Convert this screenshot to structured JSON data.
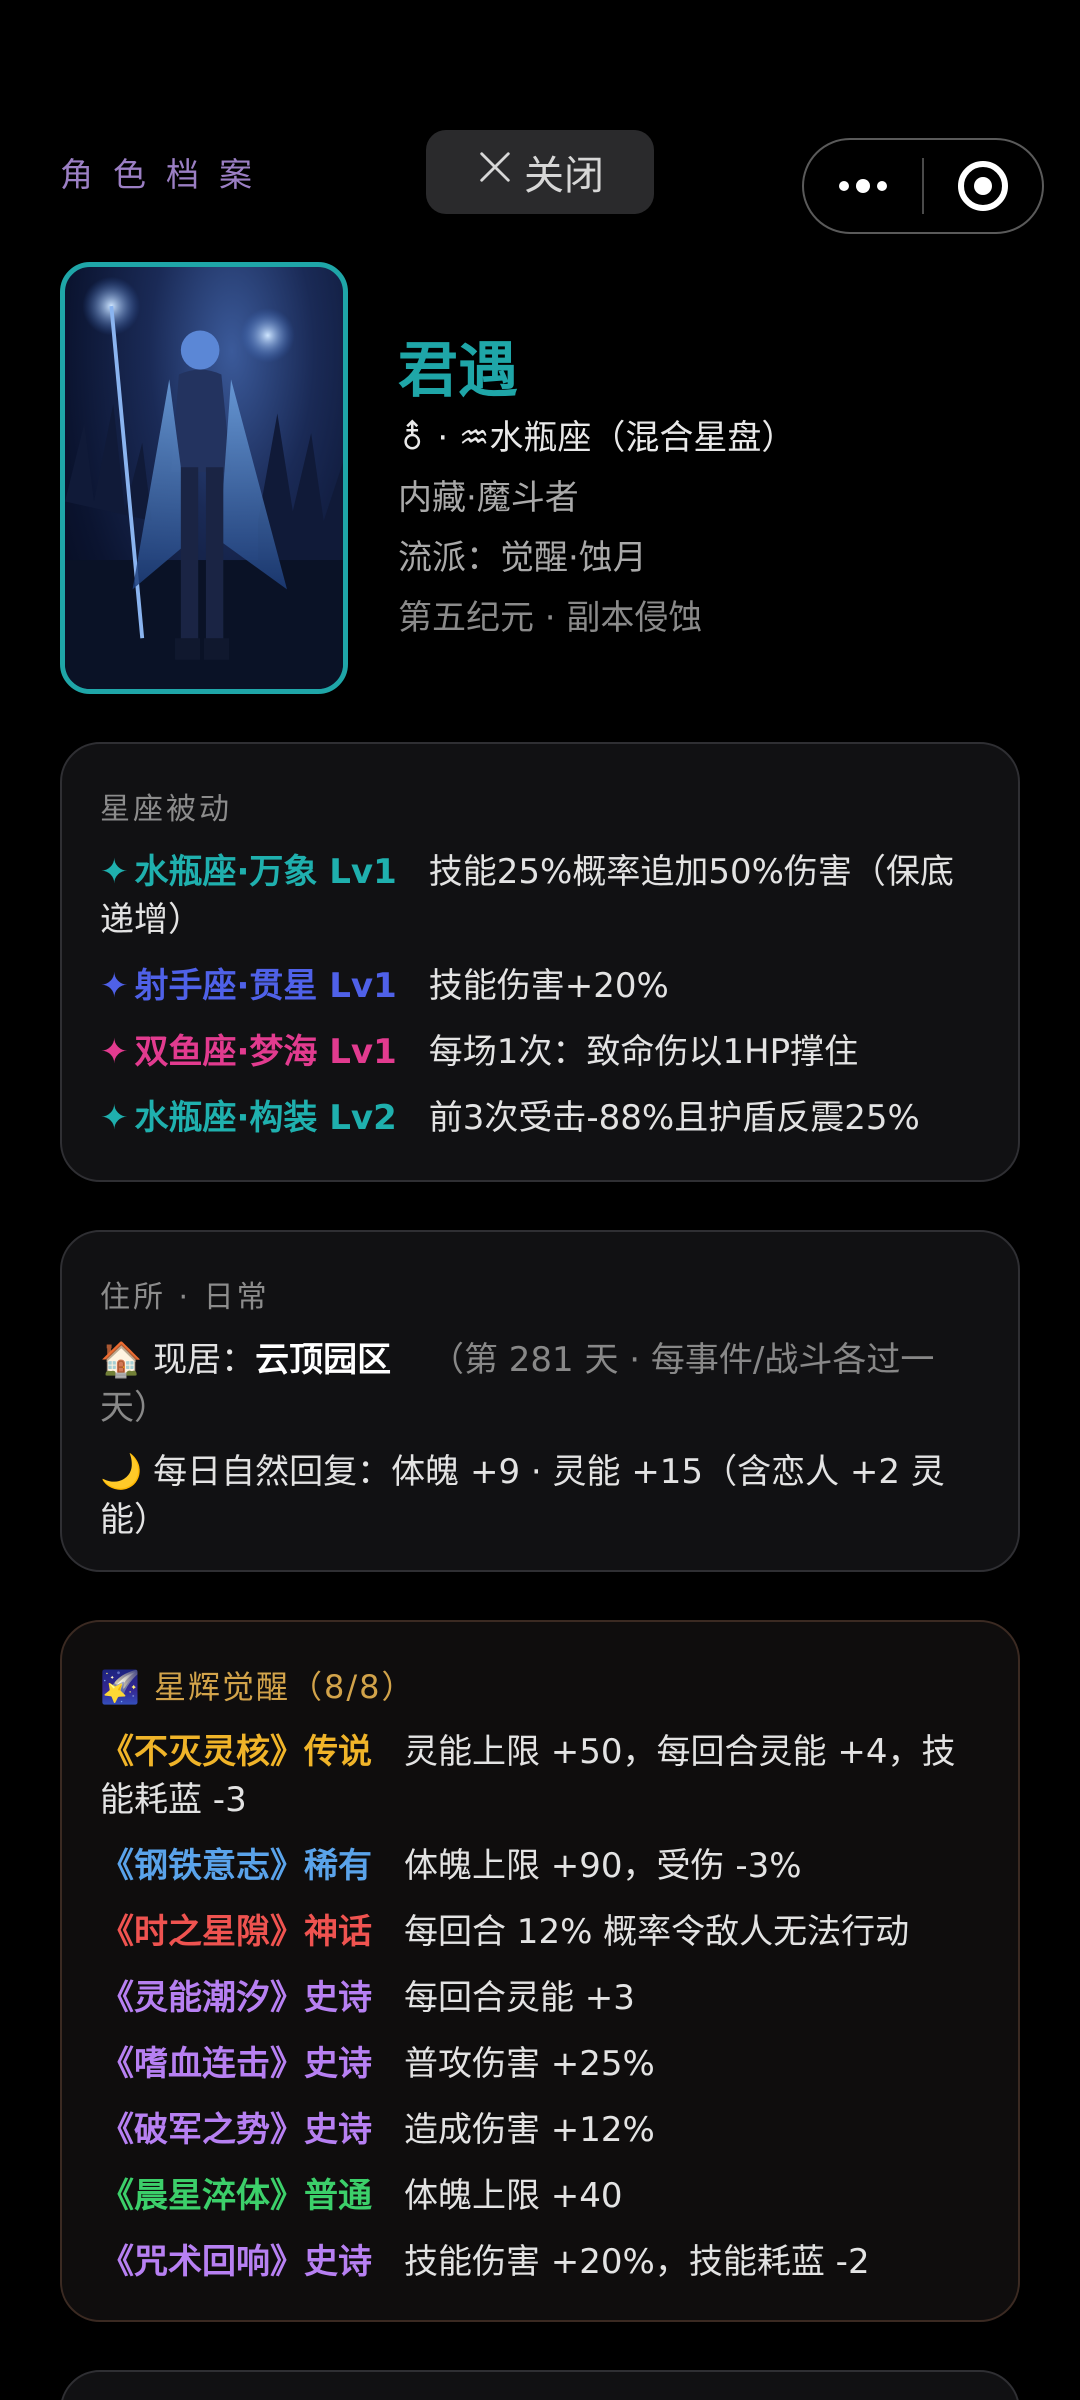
{
  "topbar": {
    "tab_title": "角色档案",
    "close_label": "关闭"
  },
  "profile": {
    "name": "君遇",
    "gender_symbol": "⚨",
    "zodiac_line": "·  ♒水瓶座（混合星盘）",
    "class_line": "内藏·魔斗者",
    "school_line": "流派：觉醒·蚀月",
    "era_line": "第五纪元 · 副本侵蚀"
  },
  "passive": {
    "title": "星座被动",
    "items": [
      {
        "mark": "✦",
        "label": "水瓶座·万象 Lv1",
        "desc": "技能25%概率追加50%伤害（保底递增）",
        "color": "#1fb0ae"
      },
      {
        "mark": "✦",
        "label": "射手座·贯星 Lv1",
        "desc": "技能伤害+20%",
        "color": "#4f61e8"
      },
      {
        "mark": "✦",
        "label": "双鱼座·梦海 Lv1",
        "desc": "每场1次：致命伤以1HP撑住",
        "color": "#e23b8f"
      },
      {
        "mark": "✦",
        "label": "水瓶座·构装 Lv2",
        "desc": "前3次受击-88%且护盾反震25%",
        "color": "#1fb0ae"
      }
    ]
  },
  "home": {
    "title": "住所 · 日常",
    "house_icon": "🏠",
    "residence_prefix": "现居：",
    "residence_name": "云顶园区",
    "residence_note": "（第 281 天 · 每事件/战斗各过一天）",
    "moon_icon": "🌙",
    "regen_text": "每日自然回复：体魄 +9 · 灵能 +15（含恋人 +2 灵能）"
  },
  "awaken": {
    "icon": "🌠",
    "title": "星辉觉醒（8/8）",
    "items": [
      {
        "label": "《不灭灵核》传说",
        "desc": "灵能上限 +50，每回合灵能 +4，技能耗蓝 -3",
        "color": "#f0b429"
      },
      {
        "label": "《钢铁意志》稀有",
        "desc": "体魄上限 +90，受伤 -3%",
        "color": "#5aa3ea"
      },
      {
        "label": "《时之星隙》神话",
        "desc": "每回合 12% 概率令敌人无法行动",
        "color": "#ef5350"
      },
      {
        "label": "《灵能潮汐》史诗",
        "desc": "每回合灵能 +3",
        "color": "#b780f2"
      },
      {
        "label": "《嗜血连击》史诗",
        "desc": "普攻伤害 +25%",
        "color": "#b780f2"
      },
      {
        "label": "《破军之势》史诗",
        "desc": "造成伤害 +12%",
        "color": "#b780f2"
      },
      {
        "label": "《晨星淬体》普通",
        "desc": "体魄上限 +40",
        "color": "#3ccf6a"
      },
      {
        "label": "《咒术回响》史诗",
        "desc": "技能伤害 +20%，技能耗蓝 -2",
        "color": "#b780f2"
      }
    ]
  }
}
